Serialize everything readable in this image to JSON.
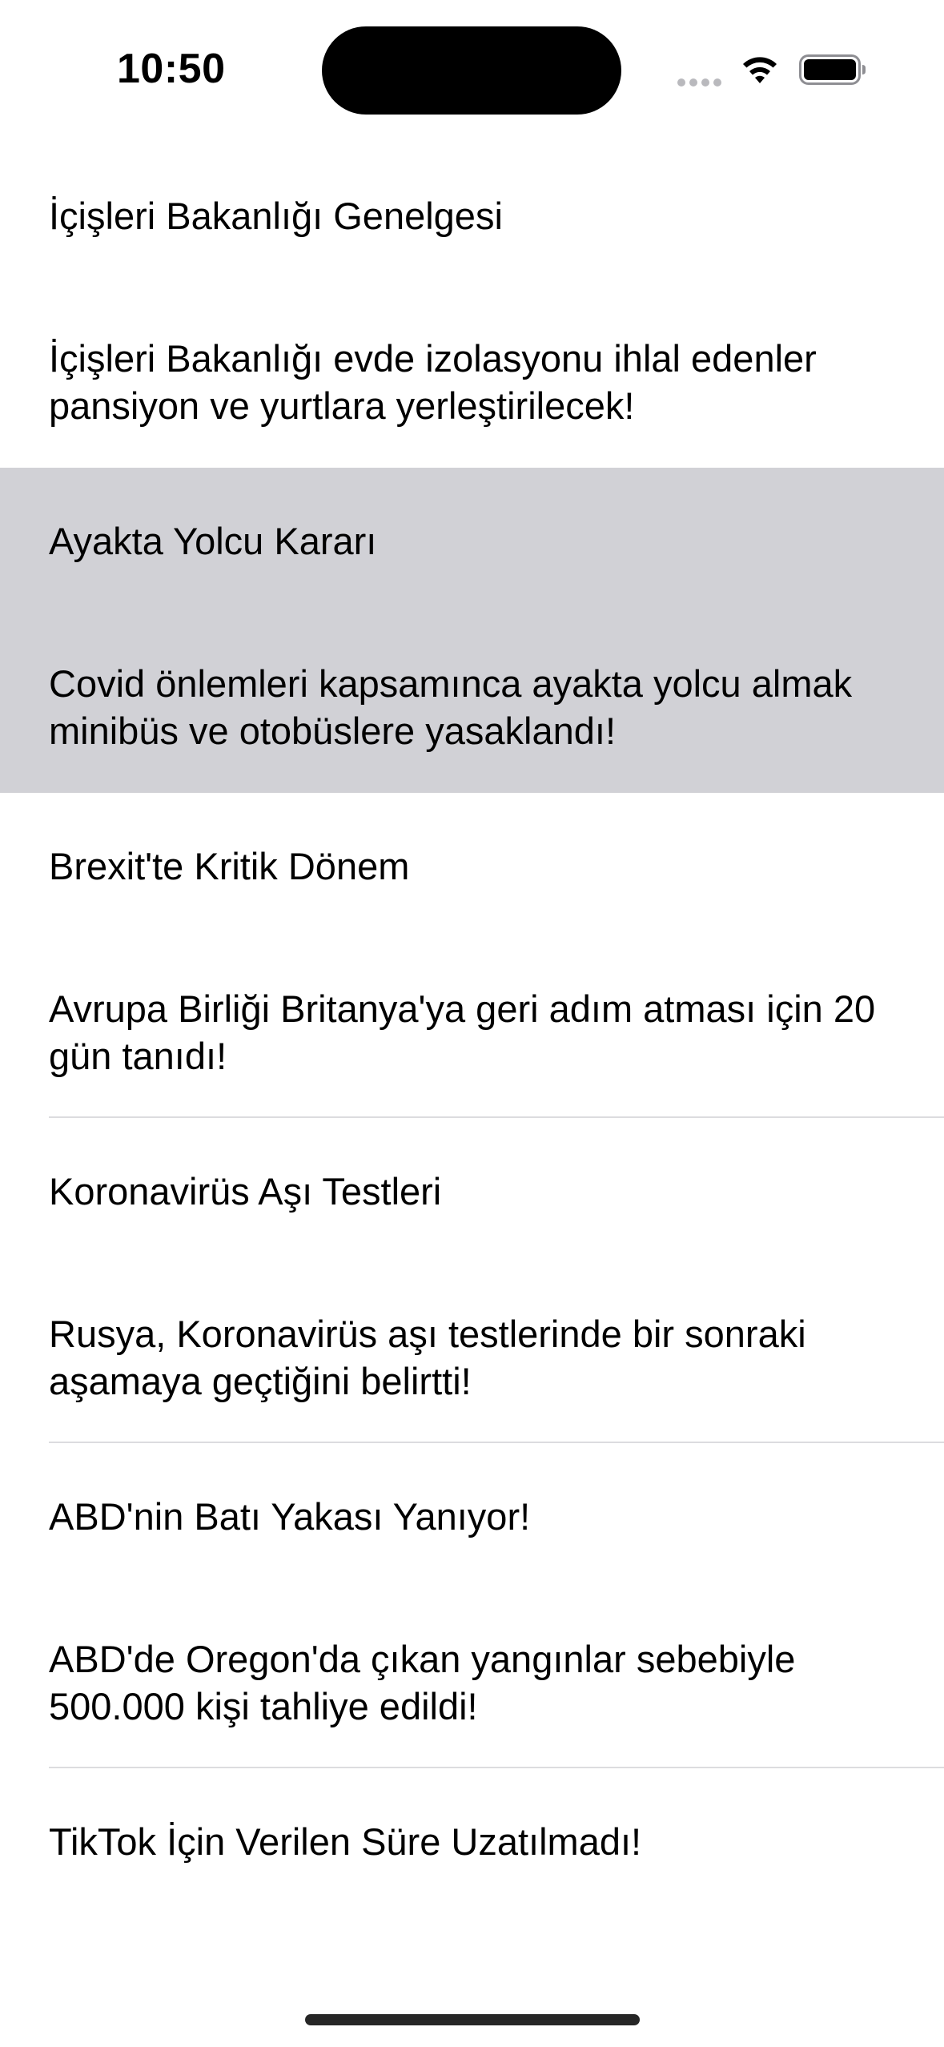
{
  "status_bar": {
    "time": "10:50",
    "wifi_icon": "wifi-icon",
    "battery_icon": "battery-icon"
  },
  "news": [
    {
      "title": "İçişleri Bakanlığı Genelgesi",
      "description": "İçişleri Bakanlığı evde izolasyonu ihlal edenler pansiyon ve yurtlara yerleştirilecek!",
      "selected": false
    },
    {
      "title": "Ayakta Yolcu Kararı",
      "description": "Covid önlemleri kapsamınca ayakta yolcu almak minibüs ve otobüslere yasaklandı!",
      "selected": true
    },
    {
      "title": "Brexit'te Kritik Dönem",
      "description": "Avrupa Birliği Britanya'ya geri adım atması için 20 gün tanıdı!",
      "selected": false
    },
    {
      "title": "Koronavirüs Aşı Testleri",
      "description": "Rusya, Koronavirüs aşı testlerinde bir sonraki aşamaya geçtiğini belirtti!",
      "selected": false
    },
    {
      "title": "ABD'nin Batı Yakası Yanıyor!",
      "description": "ABD'de Oregon'da çıkan yangınlar sebebiyle 500.000 kişi tahliye edildi!",
      "selected": false
    },
    {
      "title": "TikTok İçin Verilen Süre Uzatılmadı!",
      "description": "",
      "selected": false
    }
  ],
  "colors": {
    "selected_row": "#d1d1d6",
    "separator": "#dcdcdf",
    "text": "#000000",
    "background": "#ffffff"
  }
}
